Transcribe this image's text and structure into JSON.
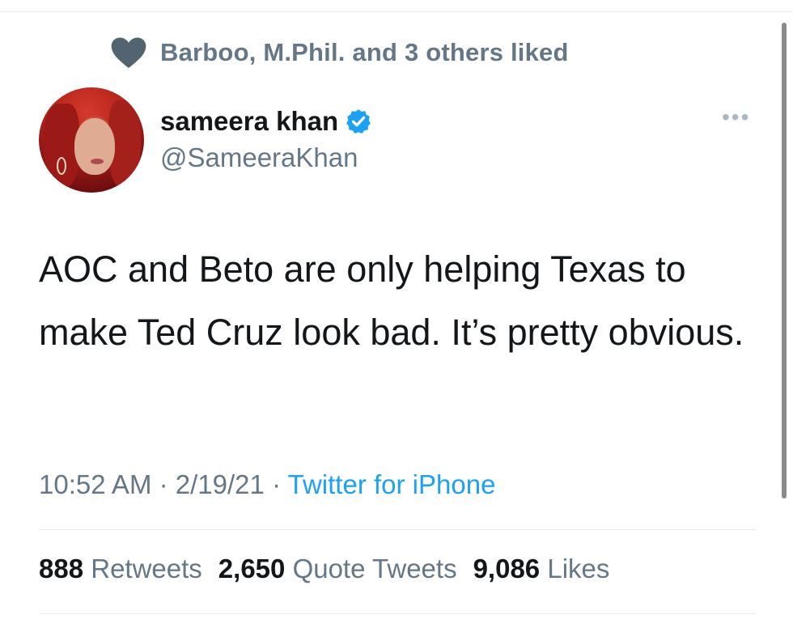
{
  "social_context": {
    "text": "Barboo, M.Phil. and 3 others liked",
    "icon": "heart-icon"
  },
  "author": {
    "display_name": "sameera khan",
    "handle": "@SameeraKhan",
    "verified": true
  },
  "tweet": {
    "text": "AOC and Beto are only helping Texas to make Ted Cruz look bad. It’s pretty obvious."
  },
  "meta": {
    "time": "10:52 AM",
    "separator": "·",
    "date": "2/19/21",
    "source": "Twitter for iPhone"
  },
  "stats": [
    {
      "count": "888",
      "label": "Retweets"
    },
    {
      "count": "2,650",
      "label": "Quote Tweets"
    },
    {
      "count": "9,086",
      "label": "Likes"
    }
  ],
  "colors": {
    "secondary_text": "#657786",
    "link": "#1da1f2",
    "heart": "#536471",
    "verified": "#1da1f2"
  }
}
